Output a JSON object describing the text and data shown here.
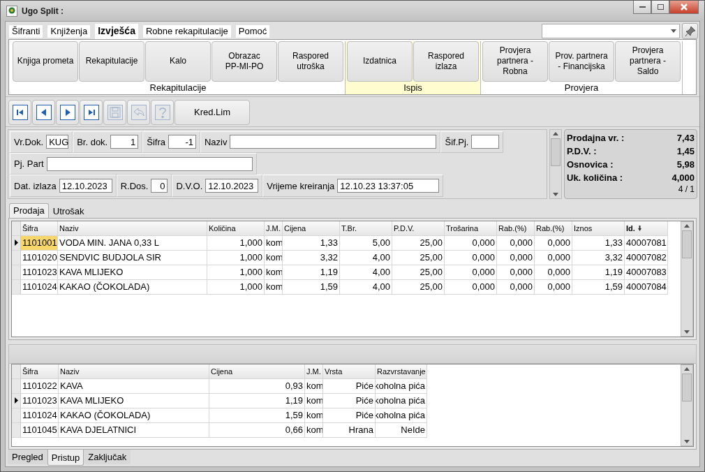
{
  "window": {
    "title": "Ugo Split :"
  },
  "menu_tabs": [
    {
      "label": "Šifranti",
      "selected": false
    },
    {
      "label": "Knjiženja",
      "selected": false
    },
    {
      "label": "Izvješća",
      "selected": true
    },
    {
      "label": "Robne rekapitulacije",
      "selected": false
    },
    {
      "label": "Pomoć",
      "selected": false
    }
  ],
  "ribbon": {
    "groups": [
      {
        "label": "Rekapitulacije",
        "highlighted": false,
        "buttons": [
          "Knjiga prometa",
          "Rekapitulacije",
          "Kalo",
          "Obrazac\nPP-MI-PO",
          "Raspored\nutroška"
        ]
      },
      {
        "label": "Ispis",
        "highlighted": true,
        "buttons": [
          "Izdatnica",
          "Raspored\nizlaza"
        ]
      },
      {
        "label": "Provjera",
        "highlighted": false,
        "buttons": [
          "Provjera\npartnera -\nRobna",
          "Prov. partnera\n- Financijska",
          "Provjera\npartnera -\nSaldo"
        ]
      }
    ]
  },
  "toolbar": [
    {
      "kind": "first",
      "disabled": false
    },
    {
      "kind": "prev",
      "disabled": false
    },
    {
      "kind": "next",
      "disabled": false
    },
    {
      "kind": "last",
      "disabled": false
    },
    {
      "kind": "save",
      "disabled": true
    },
    {
      "kind": "undo",
      "disabled": true
    },
    {
      "kind": "help",
      "disabled": true
    },
    {
      "kind": "text",
      "label": "Kred.Lim"
    }
  ],
  "form": {
    "lines": [
      {
        "fields": [
          {
            "label": "Vr.Dok.",
            "value": "KUG",
            "numeric": false
          },
          {
            "label": "Br. dok.",
            "value": "1",
            "numeric": true
          },
          {
            "label": "Šifra",
            "value": "-1",
            "numeric": true
          },
          {
            "label": "Naziv"
          },
          {
            "label": "Šif.Pj."
          }
        ]
      },
      {
        "fields": [
          {
            "label": "Pj. Part"
          }
        ]
      },
      {
        "fields": [
          {
            "label": "Dat. izlaza",
            "value": "12.10.2023",
            "numeric": false
          },
          {
            "label": "R.Dos.",
            "value": "0",
            "numeric": true
          },
          {
            "label": "D.V.O.",
            "value": "12.10.2023",
            "numeric": false
          },
          {
            "label": "Vrijeme kreiranja",
            "value": "12.10.23 13:37:05",
            "numeric": false
          }
        ]
      }
    ]
  },
  "summary": {
    "items": [
      {
        "label": "Prodajna vr. :",
        "value": "7,43"
      },
      {
        "label": "P.D.V. :",
        "value": "1,45"
      },
      {
        "label": "Osnovica :",
        "value": "5,98"
      },
      {
        "label": "Uk. količina :",
        "value": "4,000"
      }
    ],
    "counter": "4 / 1"
  },
  "detail_tabs": [
    {
      "label": "Prodaja",
      "selected": true
    },
    {
      "label": "Utrošak",
      "selected": false
    }
  ],
  "items_table": {
    "columns": [
      {
        "label": "Šifra",
        "sorted": false
      },
      {
        "label": "Naziv",
        "sorted": false
      },
      {
        "label": "Količina",
        "sorted": false
      },
      {
        "label": "J.M.",
        "sorted": false
      },
      {
        "label": "Cijena",
        "sorted": false
      },
      {
        "label": "T.Br.",
        "sorted": false
      },
      {
        "label": "P.D.V.",
        "sorted": false
      },
      {
        "label": "Trošarina",
        "sorted": false
      },
      {
        "label": "Rab.(%)",
        "sorted": false
      },
      {
        "label": "Rab.(%)",
        "sorted": false
      },
      {
        "label": "Iznos",
        "sorted": false
      },
      {
        "label": "Id.",
        "sorted": true
      }
    ],
    "rows": [
      {
        "current": true,
        "selected": true,
        "cells": [
          "1101001",
          "VODA MIN. JANA 0,33 L",
          "1,000",
          "kom",
          "1,33",
          "5,00",
          "25,00",
          "0,000",
          "0,000",
          "0,000",
          "1,33",
          "40007081"
        ]
      },
      {
        "current": false,
        "selected": false,
        "cells": [
          "1101020",
          "SENDVIC BUDJOLA SIR",
          "1,000",
          "kom",
          "3,32",
          "4,00",
          "25,00",
          "0,000",
          "0,000",
          "0,000",
          "3,32",
          "40007082"
        ]
      },
      {
        "current": false,
        "selected": false,
        "cells": [
          "1101023",
          "KAVA MLIJEKO",
          "1,000",
          "kom",
          "1,19",
          "4,00",
          "25,00",
          "0,000",
          "0,000",
          "0,000",
          "1,19",
          "40007083"
        ]
      },
      {
        "current": false,
        "selected": false,
        "cells": [
          "1101024",
          "KAKAO (ČOKOLADA)",
          "1,000",
          "kom",
          "1,59",
          "4,00",
          "25,00",
          "0,000",
          "0,000",
          "0,000",
          "1,59",
          "40007084"
        ]
      }
    ]
  },
  "articles_table": {
    "columns": [
      "Šifra",
      "Naziv",
      "Cijena",
      "J.M.",
      "Vrsta",
      "Razvrstavanje"
    ],
    "rows": [
      {
        "current": false,
        "cells": [
          "1101022",
          "KAVA",
          "0,93",
          "kom",
          "Piće",
          "koholna pića"
        ]
      },
      {
        "current": true,
        "cells": [
          "1101023",
          "KAVA MLIJEKO",
          "1,19",
          "kom",
          "Piće",
          "koholna pića"
        ]
      },
      {
        "current": false,
        "cells": [
          "1101024",
          "KAKAO (ČOKOLADA)",
          "1,59",
          "kom",
          "Piće",
          "koholna pića"
        ]
      },
      {
        "current": false,
        "cells": [
          "1101045",
          "KAVA DJELATNICI",
          "0,66",
          "kom",
          "Hrana",
          "NeIde"
        ]
      }
    ]
  },
  "bottom_tabs": [
    {
      "label": "Pregled",
      "selected": false
    },
    {
      "label": "Pristup",
      "selected": true
    },
    {
      "label": "Zaključak",
      "selected": false
    }
  ]
}
